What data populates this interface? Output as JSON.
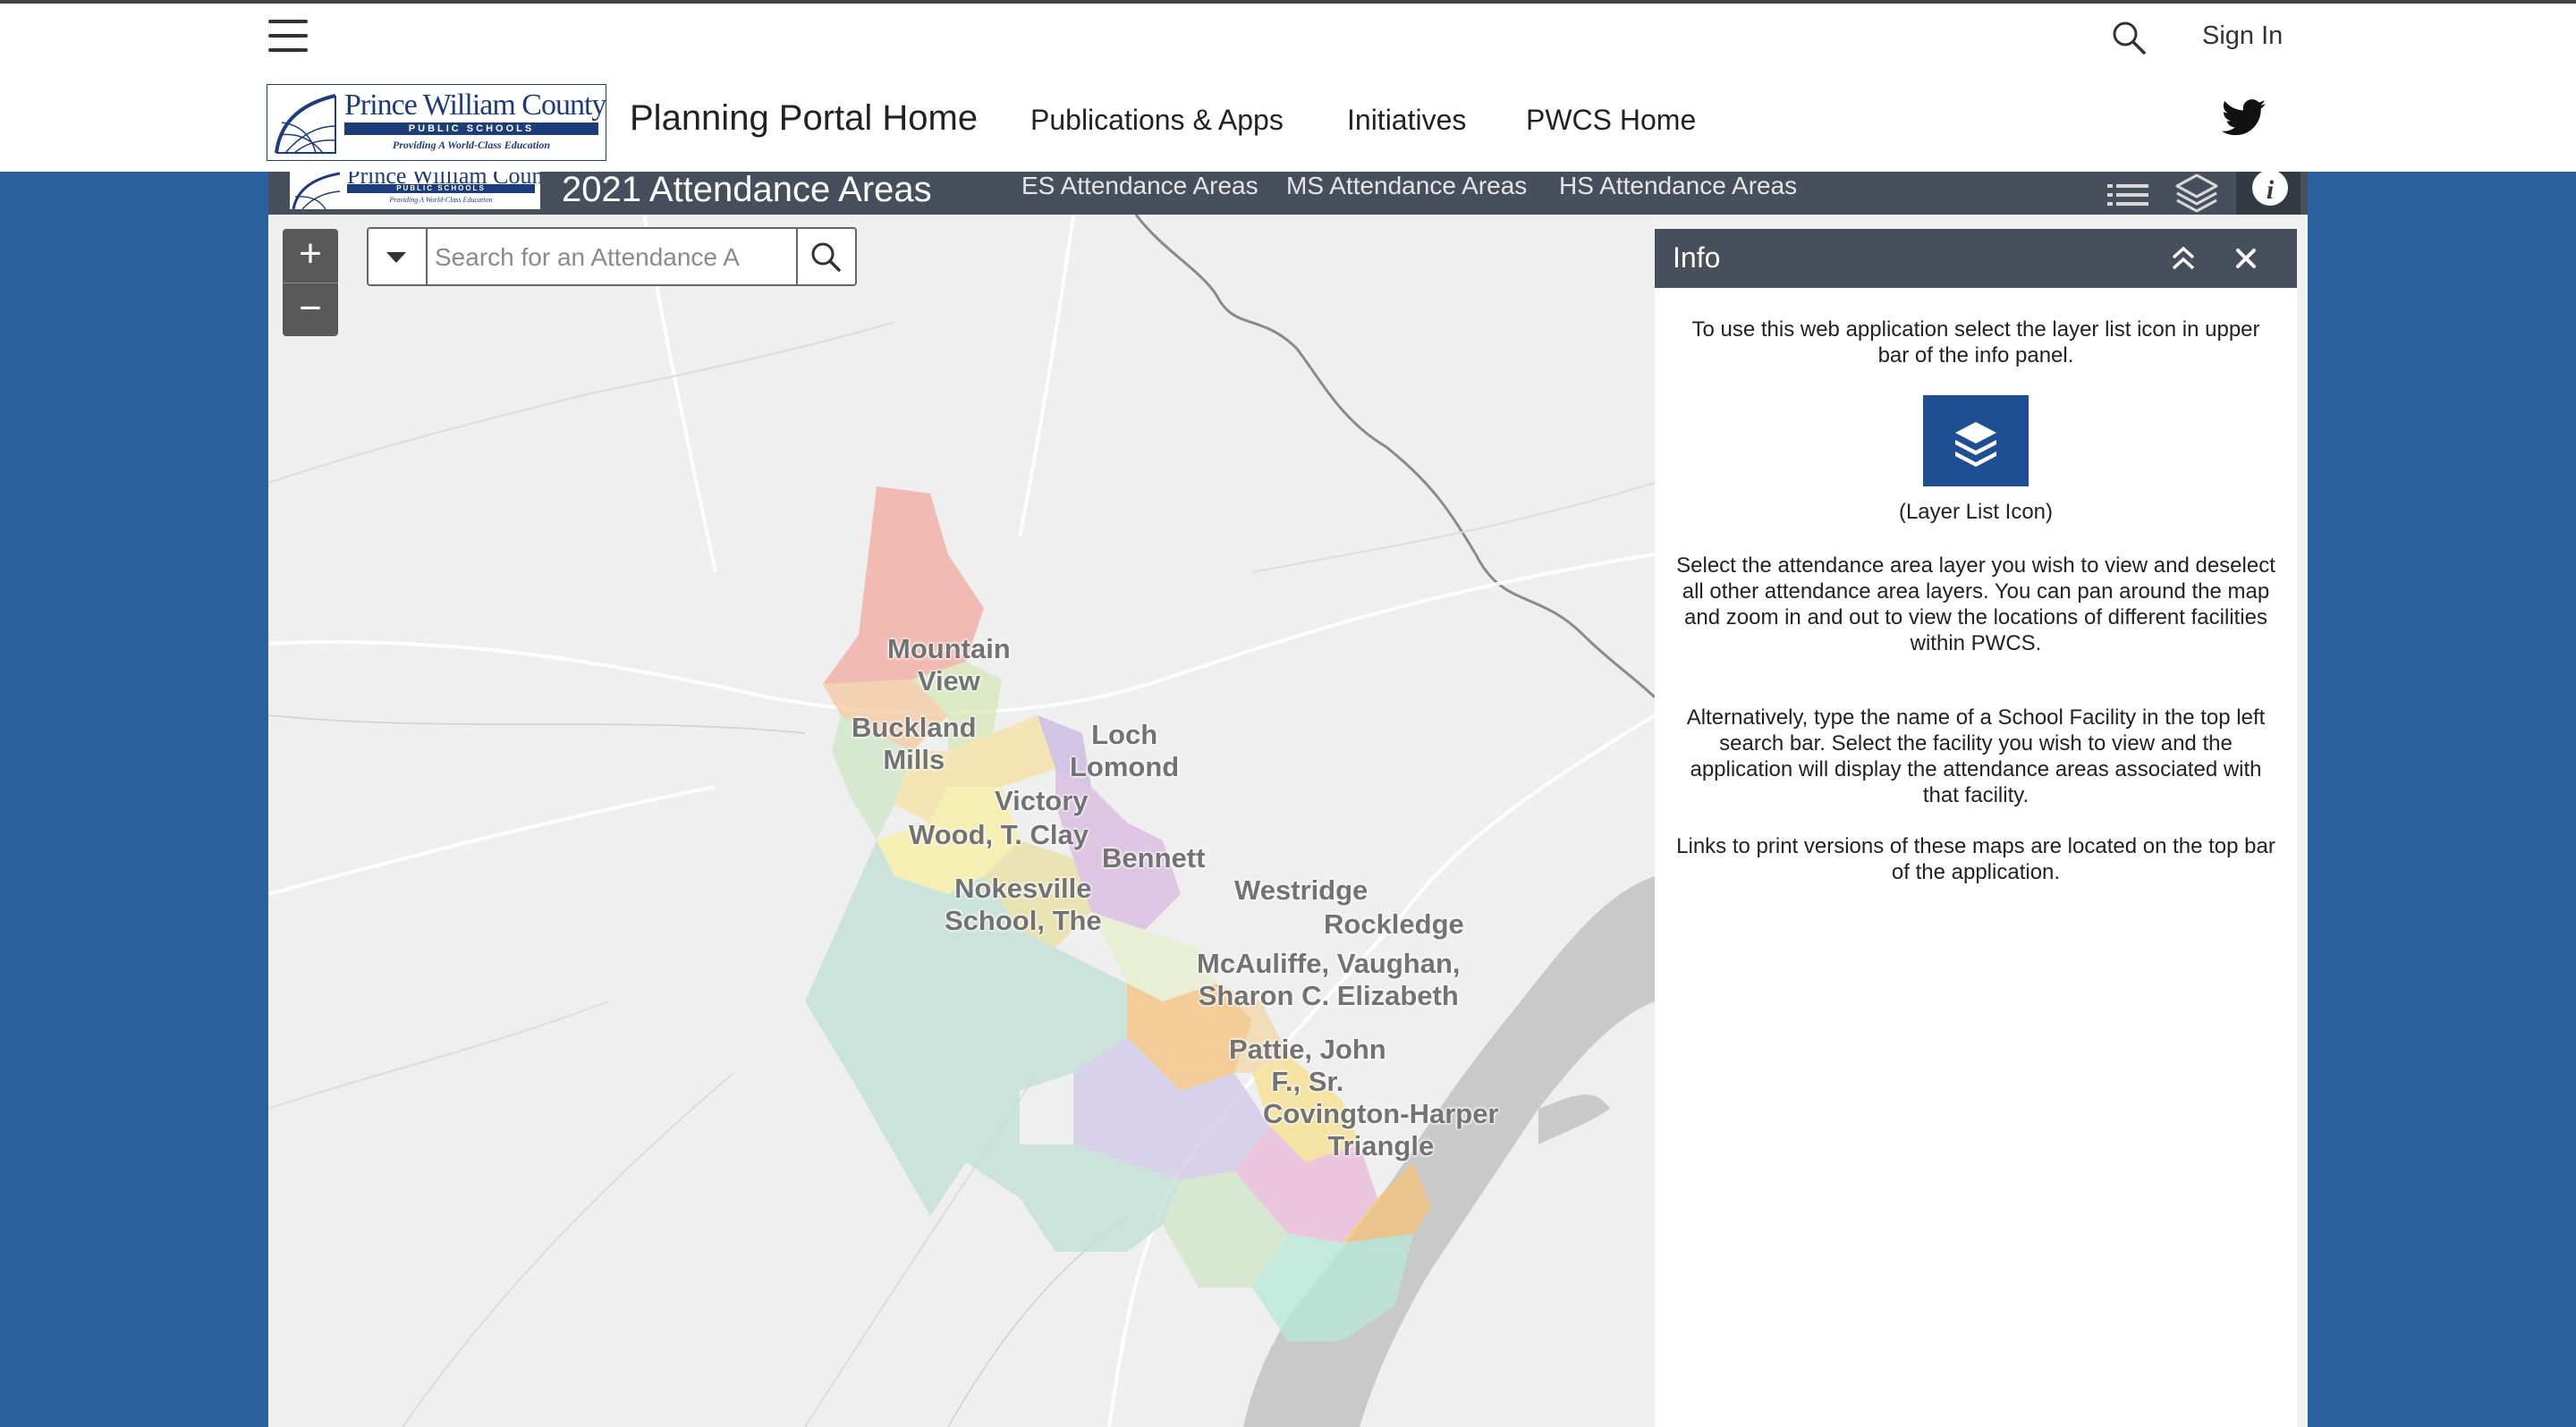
{
  "header": {
    "sign_in": "Sign In",
    "logo": {
      "name": "Prince William County",
      "sub": "PUBLIC SCHOOLS",
      "tagline": "Providing A World-Class Education"
    },
    "nav": {
      "title": "Planning Portal Home",
      "items": [
        "Publications & Apps",
        "Initiatives",
        "PWCS Home"
      ]
    }
  },
  "app_bar": {
    "title": "2021 Attendance Areas",
    "links": [
      "ES Attendance Areas",
      "MS Attendance Areas",
      "HS Attendance Areas"
    ]
  },
  "map": {
    "zoom_in": "+",
    "zoom_out": "−",
    "search_placeholder": "Search for an Attendance A",
    "labels": [
      "Mountain\nView",
      "Buckland\nMills",
      "Loch\nLomond",
      "Victory",
      "Wood, T. Clay",
      "Bennett",
      "Nokesville\nSchool, The",
      "Westridge",
      "Rockledge",
      "McAuliffe, Vaughan,\nSharon C. Elizabeth",
      "Pattie, John\nF., Sr.",
      "Covington-Harper\nTriangle"
    ]
  },
  "info_panel": {
    "title": "Info",
    "p1": "To use this web application select the layer list icon in upper bar of the info panel.",
    "icon_caption": "(Layer List Icon)",
    "p2": "Select the attendance area layer you wish to view and deselect all other attendance area layers. You can pan around the map and zoom in and out to view the locations of different facilities within PWCS.",
    "p3": "Alternatively, type the name of a School Facility in the top left search bar. Select the facility you wish to view and the application will display the attendance areas associated with that facility.",
    "p4": "Links to print versions of these maps are located on the top bar of the application."
  },
  "colors": {
    "page_bg": "#2b5f9e",
    "app_bar": "#474f5c",
    "brand_navy": "#1d3c7a",
    "layer_icon_bg": "#1f4f93"
  },
  "icons": [
    "hamburger-icon",
    "search-icon",
    "twitter-icon",
    "layer-list-icon",
    "layers-icon",
    "info-icon",
    "chevron-down-icon",
    "collapse-icon",
    "close-icon"
  ]
}
